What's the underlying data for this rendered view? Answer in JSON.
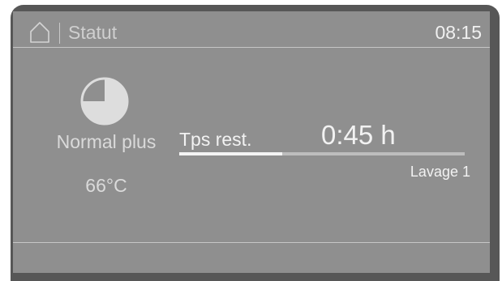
{
  "header": {
    "title": "Statut",
    "time": "08:15"
  },
  "program": {
    "name": "Normal plus",
    "temperature": "66°C",
    "icon": "pie-progress-icon",
    "icon_fraction_remaining": 0.25
  },
  "remaining": {
    "label": "Tps rest.",
    "value": "0:45 h",
    "progress_fraction": 0.36,
    "phase": "Lavage 1"
  },
  "colors": {
    "frame": "#575757",
    "screen": "#8f8f8f",
    "text_primary": "#f2f2f2",
    "text_secondary": "#d5d5d5",
    "progress_fill": "#f4f4f4",
    "progress_track": "#bdbdbd"
  }
}
